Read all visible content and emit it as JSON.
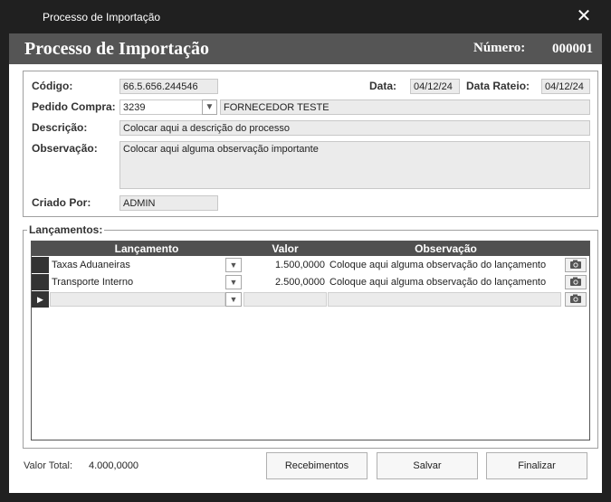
{
  "window": {
    "title": "Processo de Importação",
    "close_icon": "close-icon"
  },
  "header": {
    "title": "Processo de Importação",
    "numero_label": "Número:",
    "numero_value": "000001"
  },
  "form": {
    "codigo_label": "Código:",
    "codigo_value": "66.5.656.244546",
    "data_label": "Data:",
    "data_value": "04/12/24",
    "data_rateio_label": "Data Rateio:",
    "data_rateio_value": "04/12/24",
    "pedido_label": "Pedido Compra:",
    "pedido_value": "3239",
    "fornecedor_value": "FORNECEDOR TESTE",
    "descricao_label": "Descrição:",
    "descricao_value": "Colocar aqui a descrição do processo",
    "observacao_label": "Observação:",
    "observacao_value": "Colocar aqui alguma observação importante",
    "criado_label": "Criado Por:",
    "criado_value": "ADMIN"
  },
  "lancamentos": {
    "group_title": "Lançamentos:",
    "columns": [
      "Lançamento",
      "Valor",
      "Observação"
    ],
    "rows": [
      {
        "lancamento": "Taxas Aduaneiras",
        "valor": "1.500,0000",
        "observacao": "Coloque aqui alguma observação do lançamento"
      },
      {
        "lancamento": "Transporte Interno",
        "valor": "2.500,0000",
        "observacao": "Coloque aqui alguma observação do lançamento"
      }
    ]
  },
  "footer": {
    "valor_total_label": "Valor Total:",
    "valor_total_value": "4.000,0000",
    "recebimentos_label": "Recebimentos",
    "salvar_label": "Salvar",
    "finalizar_label": "Finalizar"
  }
}
